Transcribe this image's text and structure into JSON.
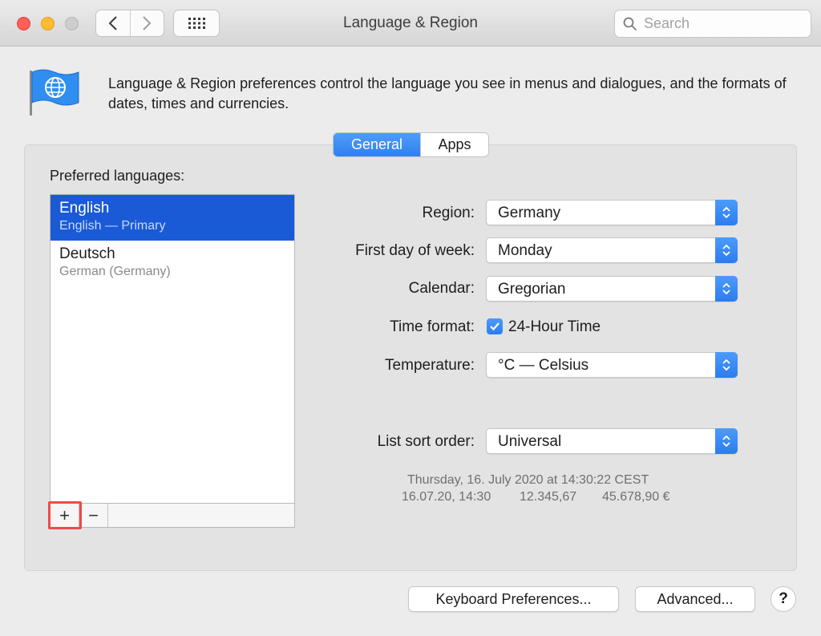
{
  "window": {
    "title": "Language & Region",
    "search_placeholder": "Search"
  },
  "header": {
    "description": "Language & Region preferences control the language you see in menus and dialogues, and the formats of dates, times and currencies."
  },
  "tabs": [
    {
      "label": "General",
      "active": true
    },
    {
      "label": "Apps",
      "active": false
    }
  ],
  "languages": {
    "title": "Preferred languages:",
    "items": [
      {
        "name": "English",
        "subtitle": "English — Primary",
        "selected": true
      },
      {
        "name": "Deutsch",
        "subtitle": "German (Germany)",
        "selected": false
      }
    ],
    "add_label": "+",
    "remove_label": "−"
  },
  "settings": {
    "region": {
      "label": "Region:",
      "value": "Germany"
    },
    "first_day": {
      "label": "First day of week:",
      "value": "Monday"
    },
    "calendar": {
      "label": "Calendar:",
      "value": "Gregorian"
    },
    "time_format": {
      "label": "Time format:",
      "checkbox_label": "24-Hour Time",
      "checked": true
    },
    "temperature": {
      "label": "Temperature:",
      "value": "°C — Celsius"
    },
    "sort_order": {
      "label": "List sort order:",
      "value": "Universal"
    }
  },
  "sample": {
    "date_long": "Thursday, 16. July 2020 at 14:30:22 CEST",
    "date_short": "16.07.20, 14:30",
    "number": "12.345,67",
    "currency": "45.678,90 €"
  },
  "buttons": {
    "keyboard": "Keyboard Preferences...",
    "advanced": "Advanced...",
    "help": "?"
  },
  "colors": {
    "accent": "#2f80f0",
    "selection": "#1a5ad6",
    "highlight": "#ee4a4a"
  }
}
